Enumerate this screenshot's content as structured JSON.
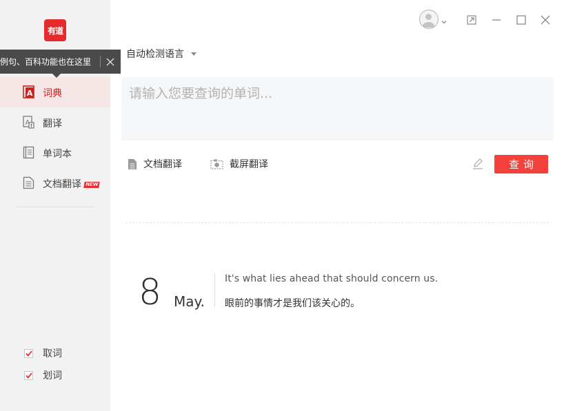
{
  "sidebar": {
    "logo_text": "有道",
    "tooltip": {
      "text": "例句、百科功能也在这里"
    },
    "nav_items": [
      {
        "label": "词典",
        "icon": "dict-icon",
        "active": true
      },
      {
        "label": "翻译",
        "icon": "translate-icon",
        "active": false
      },
      {
        "label": "单词本",
        "icon": "wordbook-icon",
        "active": false
      },
      {
        "label": "文档翻译",
        "icon": "doc-icon",
        "active": false,
        "badge": "NEW"
      }
    ],
    "checks": [
      {
        "label": "取词",
        "checked": true
      },
      {
        "label": "划词",
        "checked": true
      }
    ]
  },
  "main": {
    "language_select": "自动检测语言",
    "search": {
      "placeholder": "请输入您要查询的单词...",
      "value": ""
    },
    "doc_translate_label": "文档翻译",
    "screenshot_translate_label": "截屏翻译",
    "query_button": "查询"
  },
  "daily": {
    "day": "8",
    "month": "May.",
    "quote_en": "It's what lies ahead that should concern us.",
    "quote_zh": "眼前的事情才是我们该关心的。"
  },
  "colors": {
    "accent": "#f2413b",
    "brand": "#e52b2b",
    "sidebar_bg": "#f2f2f2"
  }
}
